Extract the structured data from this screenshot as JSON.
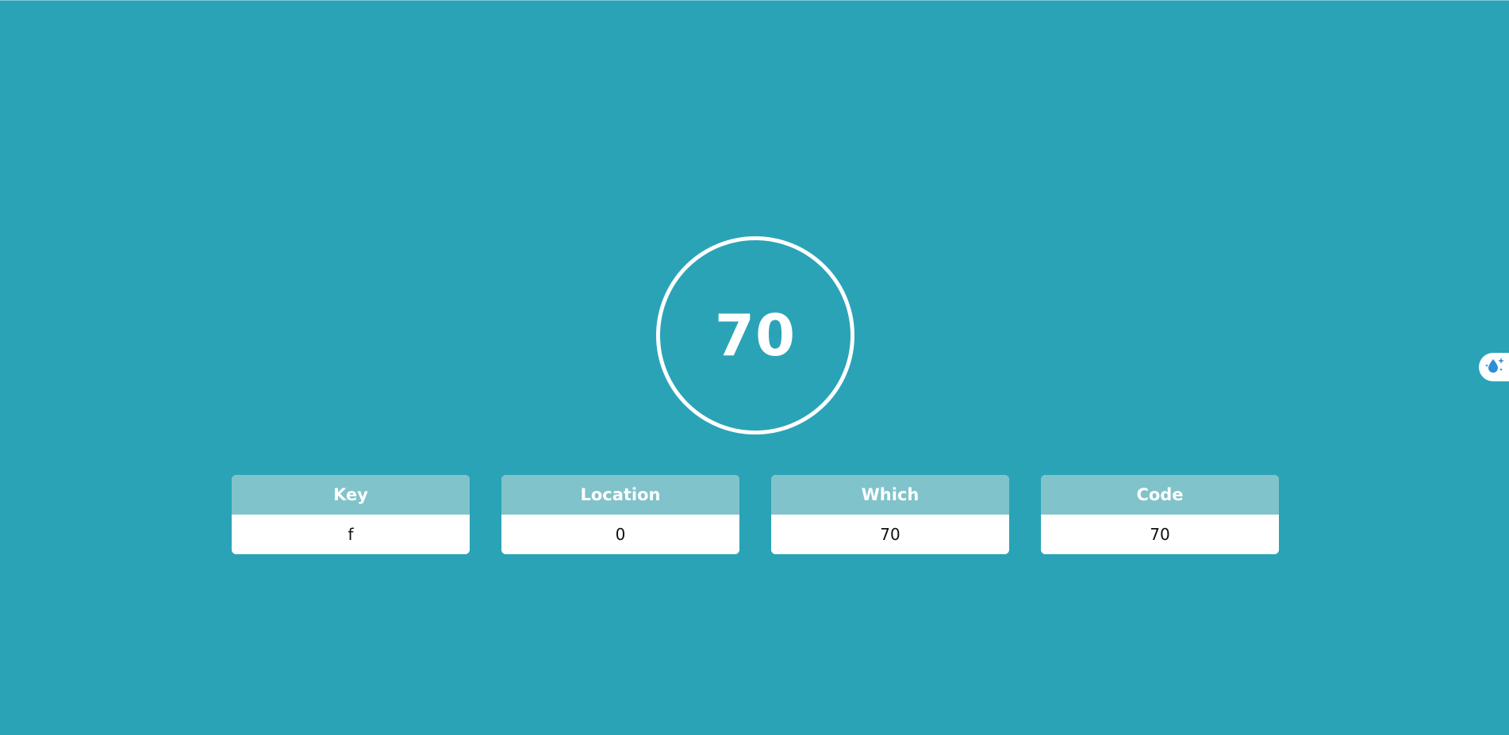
{
  "main": {
    "key_code_display": "70"
  },
  "cards": [
    {
      "label": "Key",
      "value": "f"
    },
    {
      "label": "Location",
      "value": "0"
    },
    {
      "label": "Which",
      "value": "70"
    },
    {
      "label": "Code",
      "value": "70"
    }
  ],
  "side_widget": {
    "icon": "droplet-sparkle-icon"
  },
  "colors": {
    "background": "#2aa3b7",
    "card_header": "#80c3ca",
    "card_body": "#ffffff",
    "accent_icon": "#2b8fd6"
  }
}
